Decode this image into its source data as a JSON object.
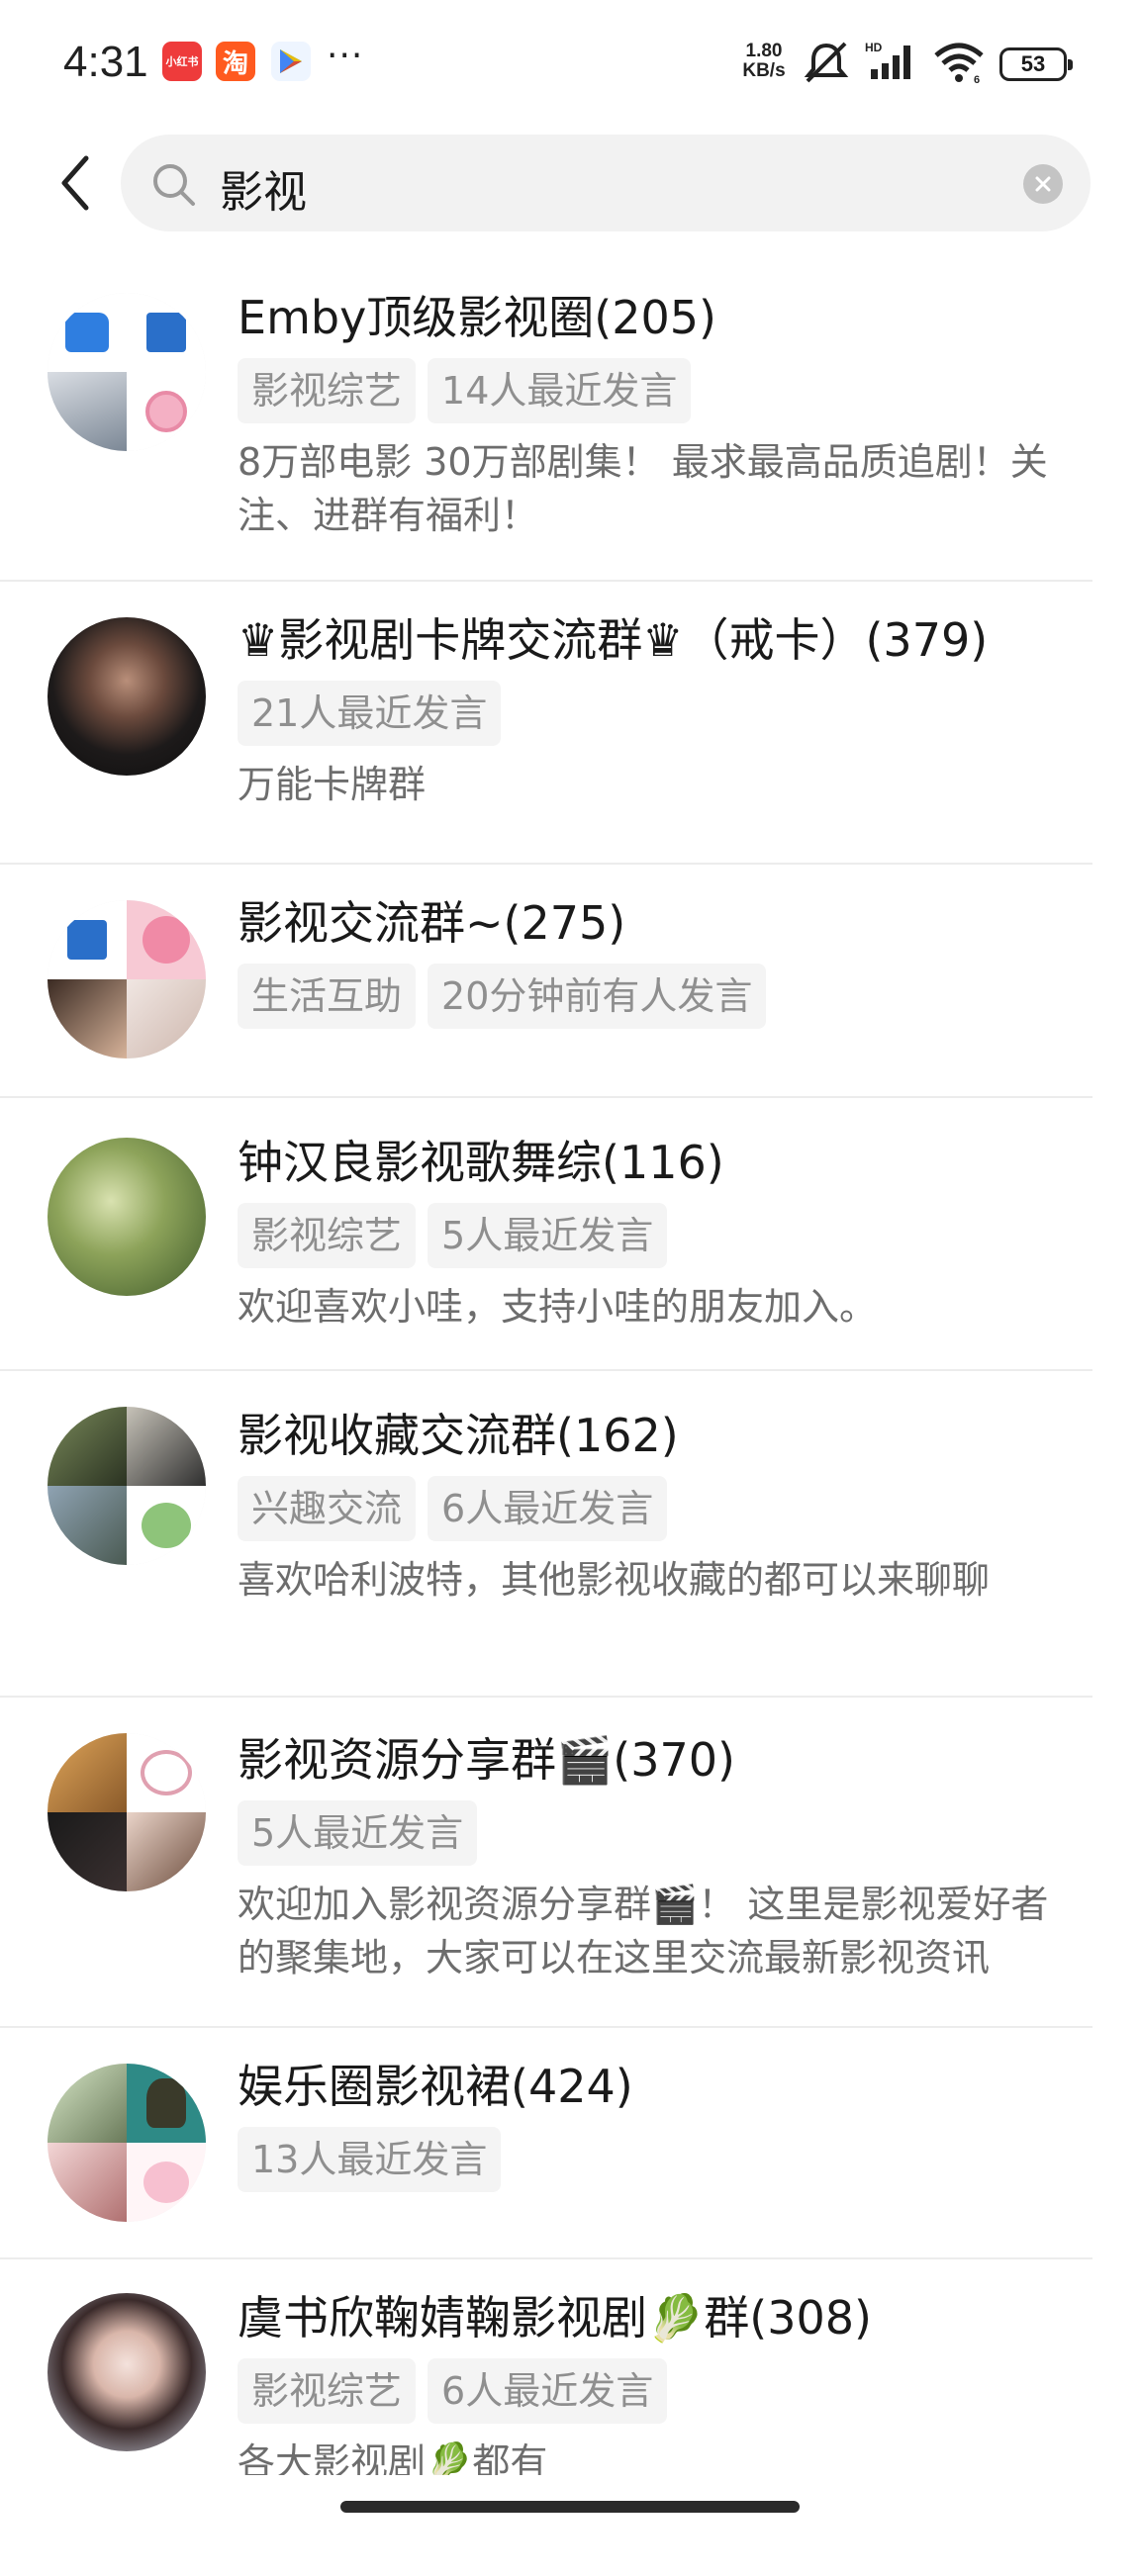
{
  "status_bar": {
    "time": "4:31",
    "app_icons": [
      "小红书",
      "淘",
      "play-store"
    ],
    "more": "···",
    "net_speed_value": "1.80",
    "net_speed_unit": "KB/s",
    "battery": "53",
    "icons": [
      "mute-icon",
      "hd-signal-icon",
      "wifi-icon",
      "battery-icon"
    ]
  },
  "search": {
    "query": "影视",
    "icons": [
      "back-icon",
      "search-icon",
      "clear-icon"
    ]
  },
  "groups": [
    {
      "title": "Emby顶级影视圈(205)",
      "tags": [
        "影视综艺",
        "14人最近发言"
      ],
      "desc": "8万部电影 30万部剧集！ 最求最高品质追剧！关注、进群有福利！"
    },
    {
      "title": "♛影视剧卡牌交流群♛（戒卡）(379)",
      "tags": [
        "21人最近发言"
      ],
      "desc": "万能卡牌群"
    },
    {
      "title": "影视交流群~(275)",
      "tags": [
        "生活互助",
        "20分钟前有人发言"
      ],
      "desc": ""
    },
    {
      "title": "钟汉良影视歌舞综(116)",
      "tags": [
        "影视综艺",
        "5人最近发言"
      ],
      "desc": "欢迎喜欢小哇，支持小哇的朋友加入。"
    },
    {
      "title": "影视收藏交流群(162)",
      "tags": [
        "兴趣交流",
        "6人最近发言"
      ],
      "desc": "喜欢哈利波特，其他影视收藏的都可以来聊聊"
    },
    {
      "title": "影视资源分享群🎬(370)",
      "tags": [
        "5人最近发言"
      ],
      "desc": "欢迎加入影视资源分享群🎬！ 这里是影视爱好者的聚集地，大家可以在这里交流最新影视资讯"
    },
    {
      "title": "娱乐圈影视裙(424)",
      "tags": [
        "13人最近发言"
      ],
      "desc": ""
    },
    {
      "title": "虞书欣鞠婧鞠影视剧🥬群(308)",
      "tags": [
        "影视综艺",
        "6人最近发言"
      ],
      "desc": "各大影视剧🥬都有"
    }
  ],
  "colors": {
    "background": "#ffffff",
    "search_bg": "#f2f2f2",
    "tag_bg": "#f4f4f4",
    "tag_text": "#8f8f8f",
    "desc_text": "#6d6d6d"
  }
}
